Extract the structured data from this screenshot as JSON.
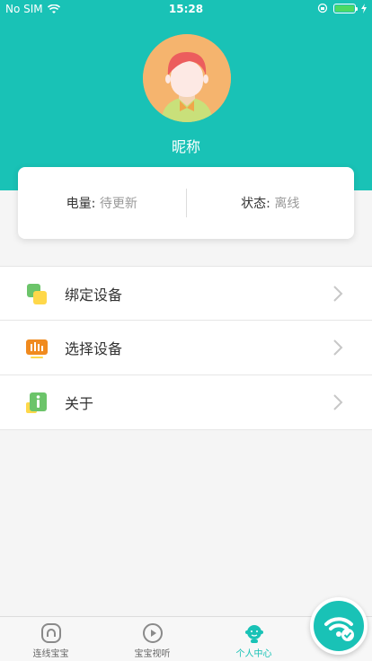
{
  "status_bar": {
    "carrier": "No SIM",
    "time": "15:28"
  },
  "profile": {
    "nickname": "昵称"
  },
  "info_card": {
    "battery_label": "电量:",
    "battery_value": "待更新",
    "status_label": "状态:",
    "status_value": "离线"
  },
  "menu": {
    "items": [
      {
        "label": "绑定设备",
        "icon": "bind-device-icon"
      },
      {
        "label": "选择设备",
        "icon": "select-device-icon"
      },
      {
        "label": "关于",
        "icon": "about-icon"
      }
    ]
  },
  "tabbar": {
    "tabs": [
      {
        "label": "连线宝宝",
        "icon": "connect-baby-icon",
        "active": false
      },
      {
        "label": "宝宝视听",
        "icon": "play-icon",
        "active": false
      },
      {
        "label": "个人中心",
        "icon": "profile-baby-icon",
        "active": true
      }
    ]
  },
  "colors": {
    "accent": "#19c2b6",
    "avatar_bg": "#f5b46e",
    "battery": "#4cd964"
  }
}
